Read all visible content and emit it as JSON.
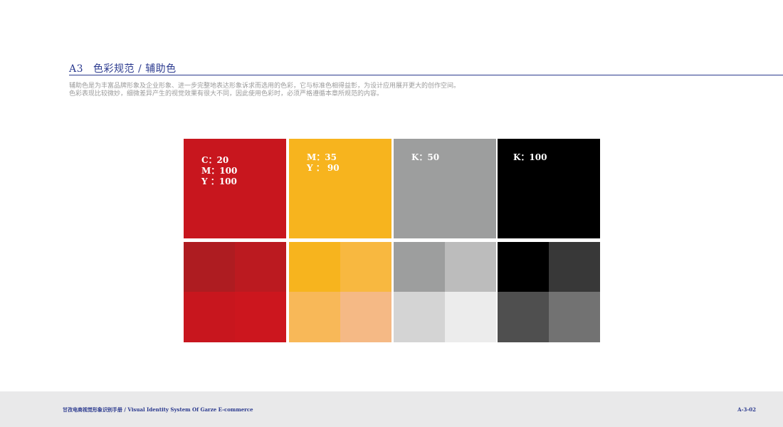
{
  "header": {
    "section_code": "A3",
    "section_title": "色彩规范 / 辅助色",
    "accent_color": "#2b3a8f"
  },
  "description": {
    "line1": "辅助色是为丰富品牌形象及企业形象、进一步完整地表达形象诉求而选用的色彩，它与标准色相得益彰，为设计应用展开更大的创作空间。",
    "line2": "色彩表现比较微妙，细微差异产生的视觉效果有很大不同，因此使用色彩时，必须严格遵循本章所规范的内容。"
  },
  "colors": [
    {
      "name": "red",
      "hex": "#c8161e",
      "values": [
        "C：20",
        "M：100",
        "Y ：100"
      ],
      "tints": [
        "#ae1c21",
        "#bb1a20",
        "#c8161e",
        "#cc161e"
      ]
    },
    {
      "name": "yellow",
      "hex": "#f7b41e",
      "values": [
        "M：35",
        "Y ： 90"
      ],
      "tints": [
        "#f7b41e",
        "#f8b840",
        "#f8b858",
        "#f5b985"
      ]
    },
    {
      "name": "gray",
      "hex": "#9d9e9e",
      "values": [
        "K：50"
      ],
      "tints": [
        "#9d9e9e",
        "#bcbcbc",
        "#d4d4d4",
        "#ececec"
      ]
    },
    {
      "name": "black",
      "hex": "#000000",
      "values": [
        "K：100"
      ],
      "tints": [
        "#000000",
        "#383838",
        "#4f4f4f",
        "#727272"
      ]
    }
  ],
  "footer": {
    "left": "甘孜电商视觉形象识别手册 / Visual Identity System Of Garze E-commerce",
    "right": "A-3-02",
    "background": "#e9e9ea"
  }
}
